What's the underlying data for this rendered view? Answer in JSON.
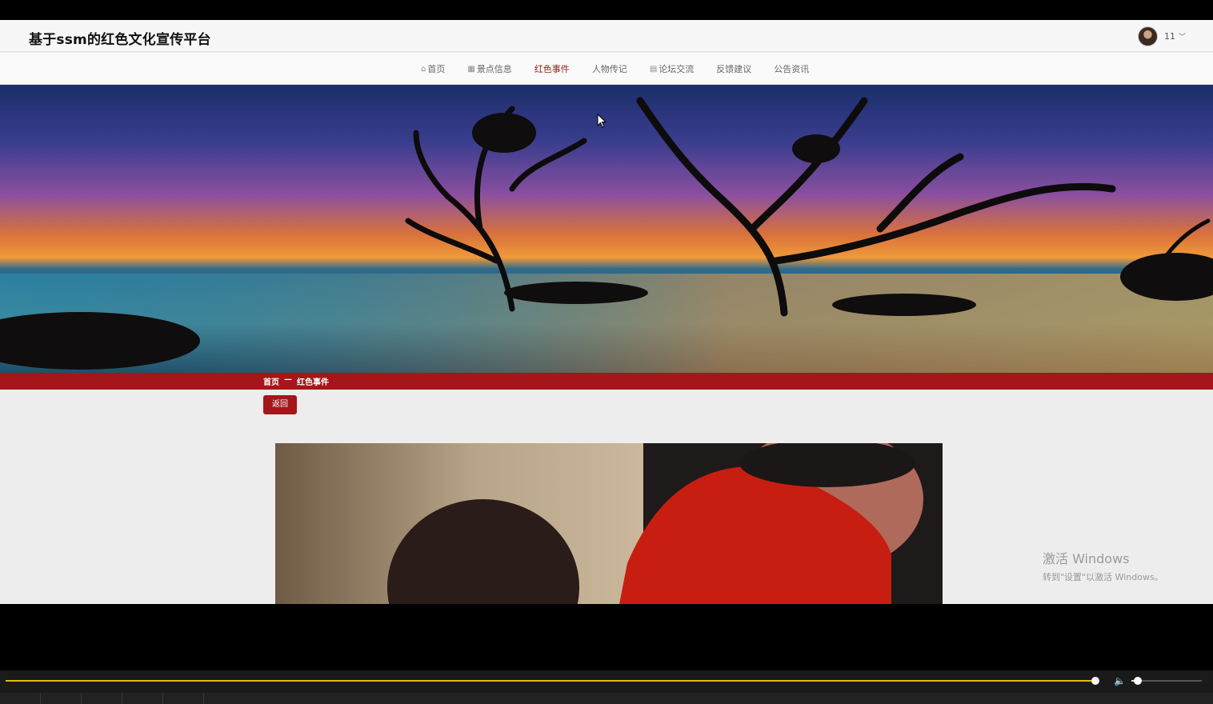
{
  "header": {
    "site_title": "基于ssm的红色文化宣传平台",
    "user_name": "11",
    "chevron": "﹀"
  },
  "nav": {
    "items": [
      {
        "icon": "home-icon",
        "label": "首页",
        "active": false
      },
      {
        "icon": "grid-icon",
        "label": "景点信息",
        "active": false
      },
      {
        "icon": "",
        "label": "红色事件",
        "active": true
      },
      {
        "icon": "",
        "label": "人物传记",
        "active": false
      },
      {
        "icon": "list-icon",
        "label": "论坛交流",
        "active": false
      },
      {
        "icon": "",
        "label": "反馈建议",
        "active": false
      },
      {
        "icon": "",
        "label": "公告资讯",
        "active": false
      }
    ]
  },
  "breadcrumb": {
    "home": "首页",
    "separator": "—",
    "current": "红色事件"
  },
  "back_button": "返回",
  "watermark": {
    "title": "激活 Windows",
    "subtitle": "转到\"设置\"以激活 Windows。"
  },
  "player": {
    "progress": 0.998,
    "volume": 0.09
  },
  "colors": {
    "accent_red": "#a5161b",
    "progress_yellow": "#e0c000"
  }
}
